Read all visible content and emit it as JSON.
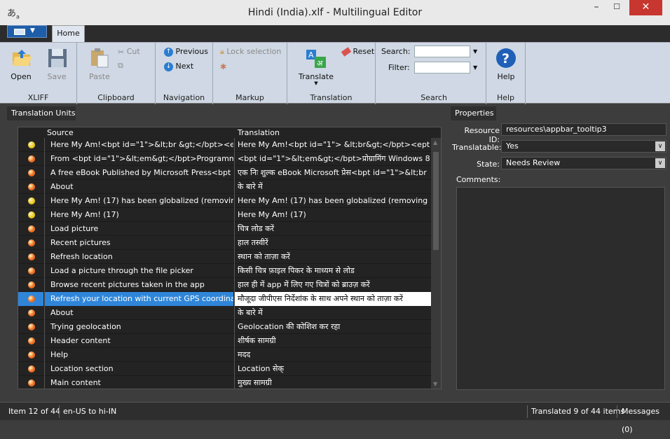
{
  "window": {
    "title": "Hindi (India).xlf - Multilingual Editor",
    "minimize": "–",
    "maximize": "☐",
    "close": "✕"
  },
  "ribbon": {
    "home_tab": "Home",
    "groups": {
      "xliff": {
        "label": "XLIFF",
        "open": "Open",
        "save": "Save"
      },
      "clipboard": {
        "label": "Clipboard",
        "paste": "Paste",
        "cut": "Cut"
      },
      "navigation": {
        "label": "Navigation",
        "previous": "Previous",
        "next": "Next"
      },
      "markup": {
        "label": "Markup",
        "lock_selection": "Lock selection"
      },
      "translation": {
        "label": "Translation",
        "translate": "Translate",
        "reset": "Reset"
      },
      "search": {
        "label": "Search",
        "search_label": "Search:",
        "filter_label": "Filter:",
        "search_value": "",
        "filter_value": ""
      },
      "help": {
        "label": "Help",
        "help": "Help"
      }
    }
  },
  "units": {
    "panel_title": "Translation Units",
    "col_source": "Source",
    "col_translation": "Translation",
    "selected_index": 11,
    "rows": [
      {
        "status": "yellow",
        "source": "Here My Am!<bpt id=\"1\">&lt;br &gt;</bpt><ept",
        "translation": "Here My Am!<bpt id=\"1\"> &lt;br&gt;</bpt><ept"
      },
      {
        "status": "orange",
        "source": "From <bpt id=\"1\">&lt;em&gt;</bpt>Programming",
        "translation": "<bpt id=\"1\">&lt;em&gt;</bpt>प्रोग्रामिंग Windows 8"
      },
      {
        "status": "orange",
        "source": "A free eBook Published by Microsoft Press<bpt",
        "translation": "एक निः शुल्क eBook Microsoft प्रेस<bpt id=\"1\">&lt;br"
      },
      {
        "status": "orange",
        "source": "About",
        "translation": "के बारे में"
      },
      {
        "status": "yellow",
        "source": "Here My Am! (17) has been globalized (removing",
        "translation": "Here My Am! (17) has been globalized (removing"
      },
      {
        "status": "yellow",
        "source": "Here My Am! (17)",
        "translation": "Here My Am! (17)"
      },
      {
        "status": "orange",
        "source": "Load picture",
        "translation": "चित्र लोड करें"
      },
      {
        "status": "orange",
        "source": "Recent pictures",
        "translation": "हाल तस्वीरें"
      },
      {
        "status": "orange",
        "source": "Refresh location",
        "translation": "स्थान को ताज़ा करें"
      },
      {
        "status": "orange",
        "source": "Load a picture through the file picker",
        "translation": "किसी चित्र फ़ाइल पिकर के माध्यम से लोड"
      },
      {
        "status": "orange",
        "source": "Browse recent pictures taken in the app",
        "translation": "हाल ही में app में लिए गए चित्रों को ब्राउज़ करें"
      },
      {
        "status": "orange",
        "source": "Refresh your location with current GPS coordinates",
        "translation": "मौजूदा जीपीएस निर्देशांक के साथ अपने स्थान को ताज़ा करें"
      },
      {
        "status": "orange",
        "source": "About",
        "translation": "के बारे में"
      },
      {
        "status": "orange",
        "source": "Trying geolocation",
        "translation": "Geolocation की कोशिश कर रहा"
      },
      {
        "status": "orange",
        "source": "Header content",
        "translation": "शीर्षक सामग्री"
      },
      {
        "status": "orange",
        "source": "Help",
        "translation": "मदद"
      },
      {
        "status": "orange",
        "source": "Location section",
        "translation": "Location सेक्"
      },
      {
        "status": "orange",
        "source": "Main content",
        "translation": "मुख्य सामग्री"
      }
    ]
  },
  "properties": {
    "panel_title": "Properties",
    "resource_id_label": "Resource ID:",
    "resource_id": "resources\\appbar_tooltip3",
    "translatable_label": "Translatable:",
    "translatable": "Yes",
    "state_label": "State:",
    "state": "Needs Review",
    "comments_label": "Comments:"
  },
  "status": {
    "item": "Item 12 of 44",
    "langs": "en-US to hi-IN",
    "translated": "Translated 9 of 44 items",
    "messages": "Messages (0)"
  },
  "colors": {
    "orange": "#f06a1c",
    "yellow": "#e8c81a",
    "selection": "#2f86d9"
  }
}
